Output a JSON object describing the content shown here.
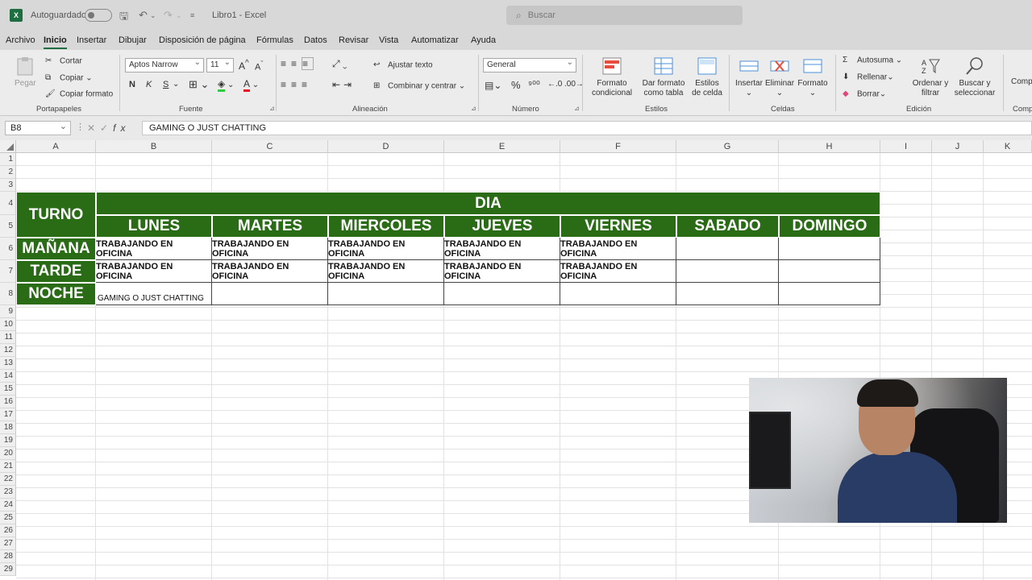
{
  "titlebar": {
    "autosave_label": "Autoguardado",
    "file_title": "Libro1 - Excel",
    "search_placeholder": "Buscar"
  },
  "menu": [
    "Archivo",
    "Inicio",
    "Insertar",
    "Dibujar",
    "Disposición de página",
    "Fórmulas",
    "Datos",
    "Revisar",
    "Vista",
    "Automatizar",
    "Ayuda"
  ],
  "ribbon": {
    "portapapeles": {
      "paste": "Pegar",
      "cut": "Cortar",
      "copy": "Copiar",
      "format_painter": "Copiar formato",
      "label": "Portapapeles"
    },
    "fuente": {
      "font": "Aptos Narrow",
      "size": "11",
      "bold": "N",
      "italic": "K",
      "underline": "S",
      "label": "Fuente"
    },
    "alineacion": {
      "wrap": "Ajustar texto",
      "merge": "Combinar y centrar",
      "label": "Alineación"
    },
    "numero": {
      "format": "General",
      "percent": "%",
      "label": "Número"
    },
    "estilos": {
      "cond": "Formato condicional",
      "table": "Dar formato como tabla",
      "cell": "Estilos de celda",
      "label": "Estilos"
    },
    "celdas": {
      "insert": "Insertar",
      "delete": "Eliminar",
      "format": "Formato",
      "label": "Celdas"
    },
    "edicion": {
      "autosum": "Autosuma",
      "fill": "Rellenar",
      "clear": "Borrar",
      "sort": "Ordenar y filtrar",
      "find": "Buscar y seleccionar",
      "label": "Edición"
    },
    "next_cut": "Comp"
  },
  "formula_bar": {
    "name_box": "B8",
    "content": "GAMING O JUST CHATTING"
  },
  "columns": [
    "A",
    "B",
    "C",
    "D",
    "E",
    "F",
    "G",
    "H",
    "I",
    "J",
    "K"
  ],
  "rows": [
    "1",
    "2",
    "3",
    "4",
    "5",
    "6",
    "7",
    "8",
    "9",
    "10",
    "11",
    "12",
    "13",
    "14",
    "15",
    "16",
    "17",
    "18",
    "19",
    "20",
    "21",
    "22",
    "23",
    "24",
    "25",
    "26",
    "27",
    "28",
    "29"
  ],
  "sheet": {
    "turno_header": "TURNO",
    "dia_header": "DIA",
    "days": [
      "LUNES",
      "MARTES",
      "MIERCOLES",
      "JUEVES",
      "VIERNES",
      "SABADO",
      "DOMINGO"
    ],
    "shifts": [
      "MAÑANA",
      "TARDE",
      "NOCHE"
    ],
    "row_manana": [
      "TRABAJANDO EN OFICINA",
      "TRABAJANDO EN OFICINA",
      "TRABAJANDO EN OFICINA",
      "TRABAJANDO EN OFICINA",
      "TRABAJANDO EN OFICINA",
      "",
      ""
    ],
    "row_tarde": [
      "TRABAJANDO EN OFICINA",
      "TRABAJANDO EN OFICINA",
      "TRABAJANDO EN OFICINA",
      "TRABAJANDO EN OFICINA",
      "TRABAJANDO EN OFICINA",
      "",
      ""
    ],
    "row_noche": [
      "GAMING O JUST CHATTING",
      "",
      "",
      "",
      "",
      "",
      ""
    ],
    "header_color": "#2a6b16"
  }
}
